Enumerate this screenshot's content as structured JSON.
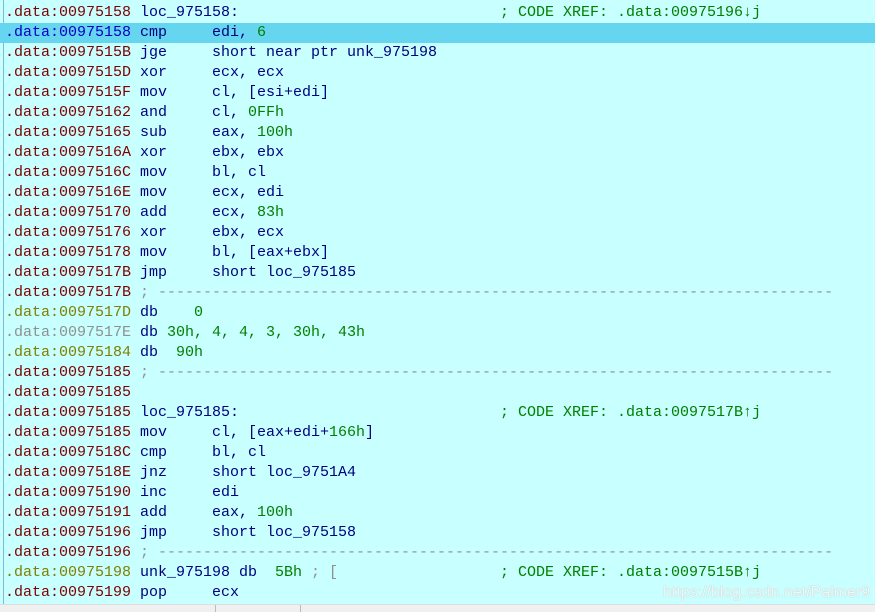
{
  "watermark": "https://blog.csdn.net/Palmer9",
  "colors": {
    "background": "#c8ffff",
    "highlight": "#66d5ef",
    "address": "#800000",
    "mnemonic": "#000080",
    "number": "#008000"
  },
  "lines": [
    {
      "addr": ".data:00975158",
      "ac": "red",
      "parts": [
        {
          "col": 15,
          "t": "loc_975158:",
          "c": "lbl"
        },
        {
          "col": 55,
          "t": "; CODE XREF: .data:00975196↓j",
          "c": "cmt"
        }
      ]
    },
    {
      "addr": ".data:00975158",
      "ac": "blue",
      "hl": true,
      "parts": [
        {
          "col": 15,
          "t": "cmp",
          "c": "mn"
        },
        {
          "col": 23,
          "t": "edi, ",
          "c": "reg"
        },
        {
          "col": 28,
          "t": "6",
          "c": "num"
        }
      ]
    },
    {
      "addr": ".data:0097515B",
      "ac": "red",
      "parts": [
        {
          "col": 15,
          "t": "jge",
          "c": "mn"
        },
        {
          "col": 23,
          "t": "short near ptr unk_975198",
          "c": "reg"
        }
      ]
    },
    {
      "addr": ".data:0097515D",
      "ac": "red",
      "parts": [
        {
          "col": 15,
          "t": "xor",
          "c": "mn"
        },
        {
          "col": 23,
          "t": "ecx, ecx",
          "c": "reg"
        }
      ]
    },
    {
      "addr": ".data:0097515F",
      "ac": "red",
      "parts": [
        {
          "col": 15,
          "t": "mov",
          "c": "mn"
        },
        {
          "col": 23,
          "t": "cl, [esi+edi]",
          "c": "reg"
        }
      ]
    },
    {
      "addr": ".data:00975162",
      "ac": "red",
      "parts": [
        {
          "col": 15,
          "t": "and",
          "c": "mn"
        },
        {
          "col": 23,
          "t": "cl, ",
          "c": "reg"
        },
        {
          "col": 27,
          "t": "0FFh",
          "c": "num"
        }
      ]
    },
    {
      "addr": ".data:00975165",
      "ac": "red",
      "parts": [
        {
          "col": 15,
          "t": "sub",
          "c": "mn"
        },
        {
          "col": 23,
          "t": "eax, ",
          "c": "reg"
        },
        {
          "col": 28,
          "t": "100h",
          "c": "num"
        }
      ]
    },
    {
      "addr": ".data:0097516A",
      "ac": "red",
      "parts": [
        {
          "col": 15,
          "t": "xor",
          "c": "mn"
        },
        {
          "col": 23,
          "t": "ebx, ebx",
          "c": "reg"
        }
      ]
    },
    {
      "addr": ".data:0097516C",
      "ac": "red",
      "parts": [
        {
          "col": 15,
          "t": "mov",
          "c": "mn"
        },
        {
          "col": 23,
          "t": "bl, cl",
          "c": "reg"
        }
      ]
    },
    {
      "addr": ".data:0097516E",
      "ac": "red",
      "parts": [
        {
          "col": 15,
          "t": "mov",
          "c": "mn"
        },
        {
          "col": 23,
          "t": "ecx, edi",
          "c": "reg"
        }
      ]
    },
    {
      "addr": ".data:00975170",
      "ac": "red",
      "parts": [
        {
          "col": 15,
          "t": "add",
          "c": "mn"
        },
        {
          "col": 23,
          "t": "ecx, ",
          "c": "reg"
        },
        {
          "col": 28,
          "t": "83h",
          "c": "num"
        }
      ]
    },
    {
      "addr": ".data:00975176",
      "ac": "red",
      "parts": [
        {
          "col": 15,
          "t": "xor",
          "c": "mn"
        },
        {
          "col": 23,
          "t": "ebx, ecx",
          "c": "reg"
        }
      ]
    },
    {
      "addr": ".data:00975178",
      "ac": "red",
      "parts": [
        {
          "col": 15,
          "t": "mov",
          "c": "mn"
        },
        {
          "col": 23,
          "t": "bl, [eax+ebx]",
          "c": "reg"
        }
      ]
    },
    {
      "addr": ".data:0097517B",
      "ac": "red",
      "parts": [
        {
          "col": 15,
          "t": "jmp",
          "c": "mn"
        },
        {
          "col": 23,
          "t": "short loc_975185",
          "c": "reg"
        }
      ]
    },
    {
      "addr": ".data:0097517B",
      "ac": "red",
      "parts": [
        {
          "col": 15,
          "t": "; ---------------------------------------------------------------------------",
          "c": "gray"
        }
      ]
    },
    {
      "addr": ".data:0097517D",
      "ac": "olive",
      "parts": [
        {
          "col": 15,
          "t": "db",
          "c": "mn"
        },
        {
          "col": 21,
          "t": "0",
          "c": "num"
        }
      ]
    },
    {
      "addr": ".data:0097517E",
      "ac": "gray",
      "parts": [
        {
          "col": 15,
          "t": "db",
          "c": "mn"
        },
        {
          "col": 18,
          "t": "30h, 4, 4, 3, 30h, 43h",
          "c": "num"
        }
      ]
    },
    {
      "addr": ".data:00975184",
      "ac": "olive",
      "parts": [
        {
          "col": 15,
          "t": "db",
          "c": "mn"
        },
        {
          "col": 19,
          "t": "90h",
          "c": "num"
        }
      ]
    },
    {
      "addr": ".data:00975185",
      "ac": "red",
      "parts": [
        {
          "col": 15,
          "t": "; ---------------------------------------------------------------------------",
          "c": "gray"
        }
      ]
    },
    {
      "addr": ".data:00975185",
      "ac": "red",
      "parts": []
    },
    {
      "addr": ".data:00975185",
      "ac": "red",
      "parts": [
        {
          "col": 15,
          "t": "loc_975185:",
          "c": "lbl"
        },
        {
          "col": 55,
          "t": "; CODE XREF: .data:0097517B↑j",
          "c": "cmt"
        }
      ]
    },
    {
      "addr": ".data:00975185",
      "ac": "red",
      "parts": [
        {
          "col": 15,
          "t": "mov",
          "c": "mn"
        },
        {
          "col": 23,
          "t": "cl, [eax+edi+",
          "c": "reg"
        },
        {
          "col": 36,
          "t": "166h",
          "c": "num"
        },
        {
          "col": 40,
          "t": "]",
          "c": "reg"
        }
      ]
    },
    {
      "addr": ".data:0097518C",
      "ac": "red",
      "parts": [
        {
          "col": 15,
          "t": "cmp",
          "c": "mn"
        },
        {
          "col": 23,
          "t": "bl, cl",
          "c": "reg"
        }
      ]
    },
    {
      "addr": ".data:0097518E",
      "ac": "red",
      "parts": [
        {
          "col": 15,
          "t": "jnz",
          "c": "mn"
        },
        {
          "col": 23,
          "t": "short loc_9751A4",
          "c": "reg"
        }
      ]
    },
    {
      "addr": ".data:00975190",
      "ac": "red",
      "parts": [
        {
          "col": 15,
          "t": "inc",
          "c": "mn"
        },
        {
          "col": 23,
          "t": "edi",
          "c": "reg"
        }
      ]
    },
    {
      "addr": ".data:00975191",
      "ac": "red",
      "parts": [
        {
          "col": 15,
          "t": "add",
          "c": "mn"
        },
        {
          "col": 23,
          "t": "eax, ",
          "c": "reg"
        },
        {
          "col": 28,
          "t": "100h",
          "c": "num"
        }
      ]
    },
    {
      "addr": ".data:00975196",
      "ac": "red",
      "parts": [
        {
          "col": 15,
          "t": "jmp",
          "c": "mn"
        },
        {
          "col": 23,
          "t": "short loc_975158",
          "c": "reg"
        }
      ]
    },
    {
      "addr": ".data:00975196",
      "ac": "red",
      "parts": [
        {
          "col": 15,
          "t": "; ---------------------------------------------------------------------------",
          "c": "gray"
        }
      ]
    },
    {
      "addr": ".data:00975198",
      "ac": "olive",
      "parts": [
        {
          "col": 15,
          "t": "unk_975198 db",
          "c": "lbl"
        },
        {
          "col": 30,
          "t": "5Bh",
          "c": "num"
        },
        {
          "col": 34,
          "t": "; [",
          "c": "gray"
        },
        {
          "col": 55,
          "t": "; CODE XREF: .data:0097515B↑j",
          "c": "cmt"
        }
      ]
    },
    {
      "addr": ".data:00975199",
      "ac": "red",
      "parts": [
        {
          "col": 15,
          "t": "pop",
          "c": "mn"
        },
        {
          "col": 23,
          "t": "ecx",
          "c": "reg"
        }
      ]
    }
  ]
}
